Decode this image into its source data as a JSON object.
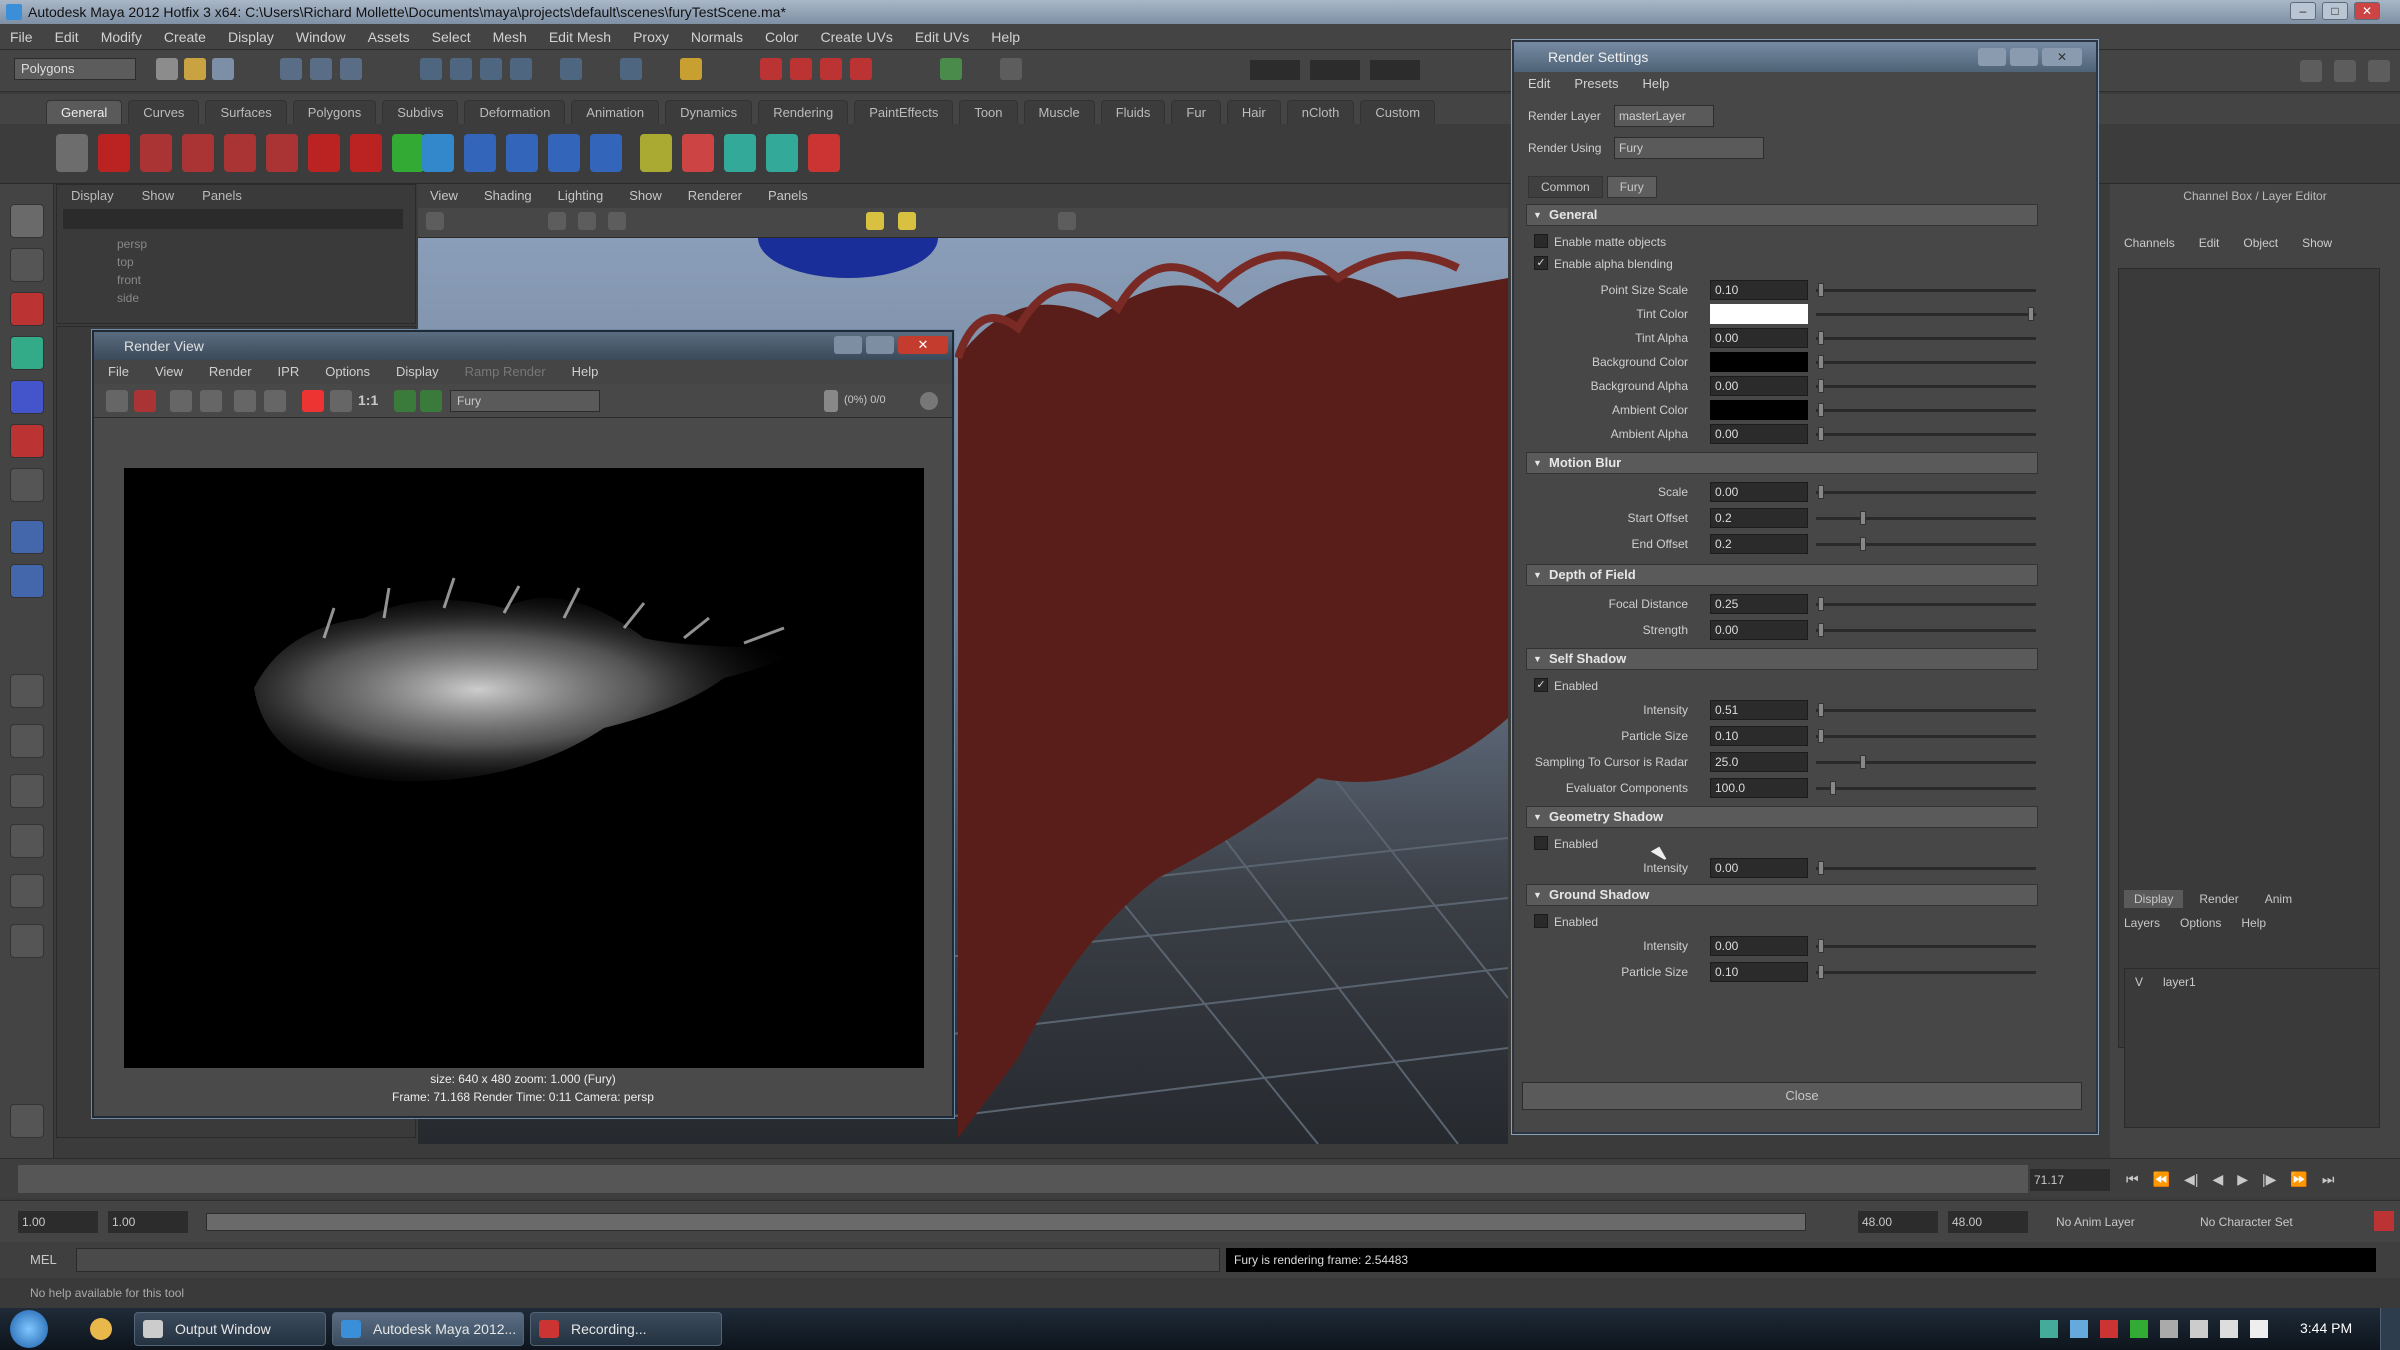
{
  "window": {
    "title": "Autodesk Maya 2012 Hotfix 3 x64: C:\\Users\\Richard Mollette\\Documents\\maya\\projects\\default\\scenes\\furyTestScene.ma*",
    "controls": [
      "–",
      "□",
      "✕"
    ]
  },
  "menubar": [
    "File",
    "Edit",
    "Modify",
    "Create",
    "Display",
    "Window",
    "Assets",
    "Select",
    "Mesh",
    "Edit Mesh",
    "Proxy",
    "Normals",
    "Color",
    "Create UVs",
    "Edit UVs",
    "Help"
  ],
  "statusline": {
    "mode": "Polygons"
  },
  "shelf_tabs": [
    "General",
    "Curves",
    "Surfaces",
    "Polygons",
    "Subdivs",
    "Deformation",
    "Animation",
    "Dynamics",
    "Rendering",
    "PaintEffects",
    "Toon",
    "Muscle",
    "Fluids",
    "Fur",
    "Hair",
    "nCloth",
    "Custom"
  ],
  "outliner": {
    "menu": [
      "Display",
      "Show",
      "Panels"
    ],
    "items": [
      "persp",
      "top",
      "front",
      "side"
    ]
  },
  "viewport": {
    "menu": [
      "View",
      "Shading",
      "Lighting",
      "Show",
      "Renderer",
      "Panels"
    ]
  },
  "render_view": {
    "title": "Render View",
    "menu": [
      "File",
      "View",
      "Render",
      "IPR",
      "Options",
      "Display",
      "Ramp Render",
      "Help"
    ],
    "renderer": "Fury",
    "ratio": "1:1",
    "zoom": "(0%) 0/0",
    "info_line1": "size: 640 x 480 zoom: 1.000        (Fury)",
    "info_line2": "Frame: 71.168        Render Time: 0:11        Camera: persp"
  },
  "render_settings": {
    "title": "Render Settings",
    "menu": [
      "Edit",
      "Presets",
      "Help"
    ],
    "render_layer_label": "Render Layer",
    "render_layer_value": "masterLayer",
    "render_using_label": "Render Using",
    "render_using_value": "Fury",
    "tabs": [
      "Common",
      "Fury"
    ],
    "sections": {
      "general": "General",
      "motion_blur": "Motion Blur",
      "dof": "Depth of Field",
      "self_shadow": "Self Shadow",
      "geo_shadow": "Geometry Shadow",
      "ground_shadow": "Ground Shadow"
    },
    "general": {
      "enable_matte": "Enable matte objects",
      "enable_alpha": "Enable alpha blending",
      "point_size_label": "Point Size Scale",
      "point_size": "0.10",
      "tint_color_label": "Tint Color",
      "tint_alpha_label": "Tint Alpha",
      "tint_alpha": "0.00",
      "bg_color_label": "Background Color",
      "bg_alpha_label": "Background Alpha",
      "bg_alpha": "0.00",
      "ambient_color_label": "Ambient Color",
      "ambient_alpha_label": "Ambient Alpha",
      "ambient_alpha": "0.00"
    },
    "motion_blur": {
      "scale_label": "Scale",
      "scale": "0.00",
      "start_label": "Start Offset",
      "start": "0.2",
      "end_label": "End Offset",
      "end": "0.2"
    },
    "dof": {
      "focal_label": "Focal Distance",
      "focal": "0.25",
      "strength_label": "Strength",
      "strength": "0.00"
    },
    "self_shadow": {
      "enabled": "Enabled",
      "intensity_label": "Intensity",
      "intensity": "0.51",
      "particle_size_label": "Particle Size",
      "particle_size": "0.10",
      "sampling_label": "Sampling To Cursor is Radar",
      "sampling": "25.0",
      "evaluator_label": "Evaluator Components",
      "evaluator": "100.0"
    },
    "geo_shadow": {
      "enabled": "Enabled",
      "intensity_label": "Intensity",
      "intensity": "0.00"
    },
    "ground_shadow": {
      "enabled": "Enabled",
      "intensity_label": "Intensity",
      "intensity": "0.00",
      "particle_size_label": "Particle Size",
      "particle_size": "0.10"
    },
    "close_label": "Close"
  },
  "right_panel": {
    "header": "Channel Box / Layer Editor",
    "tabs": [
      "Channels",
      "Edit",
      "Object",
      "Show"
    ],
    "layer_tabs": [
      "Display",
      "Render",
      "Anim"
    ],
    "layer_menu": [
      "Layers",
      "Options",
      "Help"
    ],
    "layer_item": "layer1"
  },
  "range": {
    "start": "1.00",
    "start2": "1.00",
    "end": "48.00",
    "end2": "48.00",
    "current": "71.17",
    "anim_layer": "No Anim Layer",
    "char_set": "No Character Set"
  },
  "cmdline": {
    "label": "MEL",
    "output": "Fury is rendering frame: 2.54483"
  },
  "helpline": "No help available for this tool",
  "taskbar": {
    "buttons": [
      "Output Window",
      "Autodesk Maya 2012...",
      "Recording..."
    ],
    "clock": "3:44 PM"
  },
  "colors": {
    "accent": "#6f8aa6",
    "tint": "#ffffff",
    "fur_red": "#5a1e1a",
    "panel": "#474747"
  }
}
